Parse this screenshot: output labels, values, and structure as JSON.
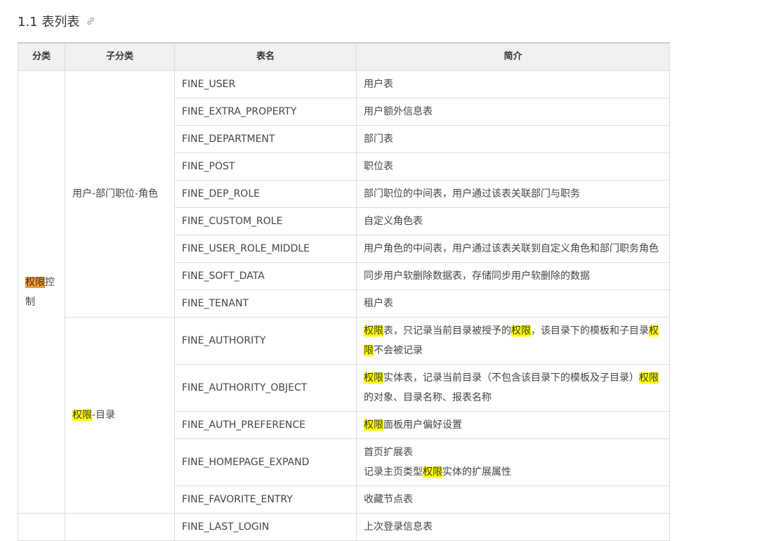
{
  "section": {
    "title": "1.1 表列表",
    "link_icon": "link-icon"
  },
  "table": {
    "headers": [
      "分类",
      "子分类",
      "表名",
      "简介"
    ],
    "category1": {
      "hl": "权限",
      "rest_a": "控",
      "rest_b": "制"
    },
    "sub1": "用户-部门职位-角色",
    "sub2": {
      "hl": "权限",
      "rest": "-目录"
    },
    "rows": [
      {
        "name": "FINE_USER",
        "desc": "用户表"
      },
      {
        "name": "FINE_EXTRA_PROPERTY",
        "desc": "用户额外信息表"
      },
      {
        "name": "FINE_DEPARTMENT",
        "desc": "部门表"
      },
      {
        "name": "FINE_POST",
        "desc": "职位表"
      },
      {
        "name": "FINE_DEP_ROLE",
        "desc": "部门职位的中间表，用户通过该表关联部门与职务"
      },
      {
        "name": "FINE_CUSTOM_ROLE",
        "desc": "自定义角色表"
      },
      {
        "name": "FINE_USER_ROLE_MIDDLE",
        "desc": "用户角色的中间表，用户通过该表关联到自定义角色和部门职务角色"
      },
      {
        "name": "FINE_SOFT_DATA",
        "desc": "同步用户软删除数据表，存储同步用户软删除的数据"
      },
      {
        "name": "FINE_TENANT",
        "desc": "租户表"
      },
      {
        "name": "FINE_AUTHORITY",
        "d1": "权限",
        "d2": "表，只记录当前目录被授予的",
        "d3": "权限",
        "d4": "，该目录下的模板和子目录",
        "d5": "权",
        "d6": "限",
        "d7": "不会被记录"
      },
      {
        "name": "FINE_AUTHORITY_OBJECT",
        "d1": "权限",
        "d2": "实体表，记录当前目录（不包含该目录下的模板及子目录）",
        "d3": "权限",
        "d4": "的对象、目录名称、报表名称"
      },
      {
        "name": "FINE_AUTH_PREFERENCE",
        "d1": "权限",
        "d2": "面板用户偏好设置"
      },
      {
        "name": "FINE_HOMEPAGE_EXPAND",
        "l1": "首页扩展表",
        "d1": "记录主页类型",
        "d2": "权限",
        "d3": "实体的扩展属性"
      },
      {
        "name": "FINE_FAVORITE_ENTRY",
        "desc": "收藏节点表"
      },
      {
        "name": "FINE_LAST_LOGIN",
        "desc": "上次登录信息表"
      }
    ]
  }
}
